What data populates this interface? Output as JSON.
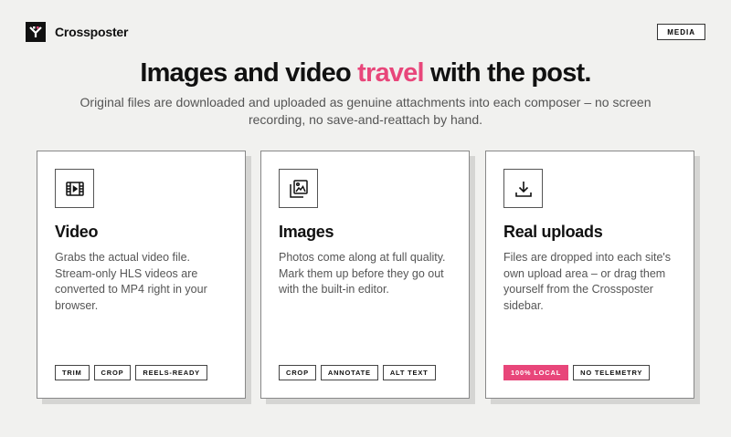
{
  "brand": {
    "name": "Crossposter",
    "logo_icon": "crossposter-logo"
  },
  "topbar": {
    "media_label": "MEDIA"
  },
  "headline": {
    "before": "Images and video ",
    "accent": "travel",
    "after": " with the post.",
    "accent_color": "#e8467a"
  },
  "subtitle": "Original files are downloaded and uploaded as genuine attachments into each composer – no screen recording, no save-and-reattach by hand.",
  "cards": [
    {
      "icon": "film-icon",
      "title": "Video",
      "description": "Grabs the actual video file. Stream-only HLS videos are converted to MP4 right in your browser.",
      "tags": [
        "TRIM",
        "CROP",
        "REELS-READY"
      ]
    },
    {
      "icon": "image-gallery-icon",
      "title": "Images",
      "description": "Photos come along at full quality. Mark them up before they go out with the built-in editor.",
      "tags": [
        "CROP",
        "ANNOTATE",
        "ALT TEXT"
      ]
    },
    {
      "icon": "download-icon",
      "title": "Real uploads",
      "description": "Files are dropped into each site's own upload area – or drag them yourself from the Crossposter sidebar.",
      "tags": [
        "100% LOCAL",
        "NO TELEMETRY"
      ],
      "highlight_tag": "100% LOCAL"
    }
  ]
}
